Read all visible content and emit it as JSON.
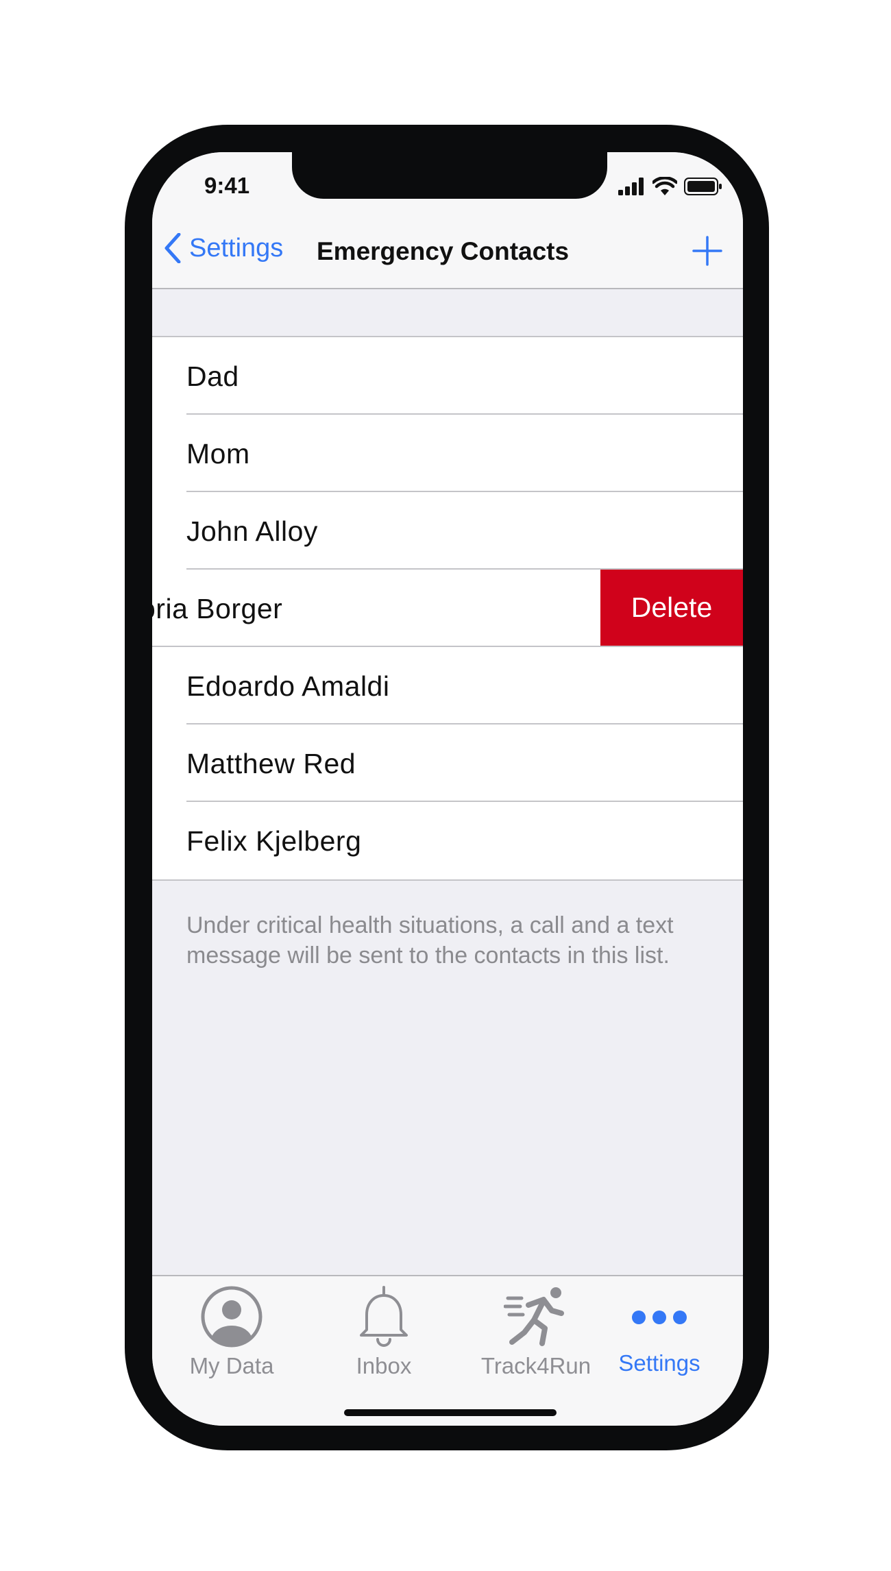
{
  "status_bar": {
    "time": "9:41"
  },
  "nav": {
    "back_label": "Settings",
    "title": "Emergency Contacts"
  },
  "contacts": [
    {
      "name": "Dad"
    },
    {
      "name": "Mom"
    },
    {
      "name": "John Alloy"
    },
    {
      "name": "oria Borger",
      "swiped": true
    },
    {
      "name": "Edoardo Amaldi"
    },
    {
      "name": "Matthew Red"
    },
    {
      "name": "Felix Kjelberg"
    }
  ],
  "delete_label": "Delete",
  "footer_note": "Under critical health situations, a call and a text message will be sent to the contacts in this list.",
  "tabs": [
    {
      "label": "My Data",
      "icon": "person-circle-icon",
      "active": false
    },
    {
      "label": "Inbox",
      "icon": "bell-icon",
      "active": false
    },
    {
      "label": "Track4Run",
      "icon": "running-icon",
      "active": false
    },
    {
      "label": "Settings",
      "icon": "more-dots-icon",
      "active": true
    }
  ],
  "colors": {
    "accent": "#3478f6",
    "delete": "#d0021b",
    "inactive": "#8e8e93",
    "background": "#efeff4"
  }
}
